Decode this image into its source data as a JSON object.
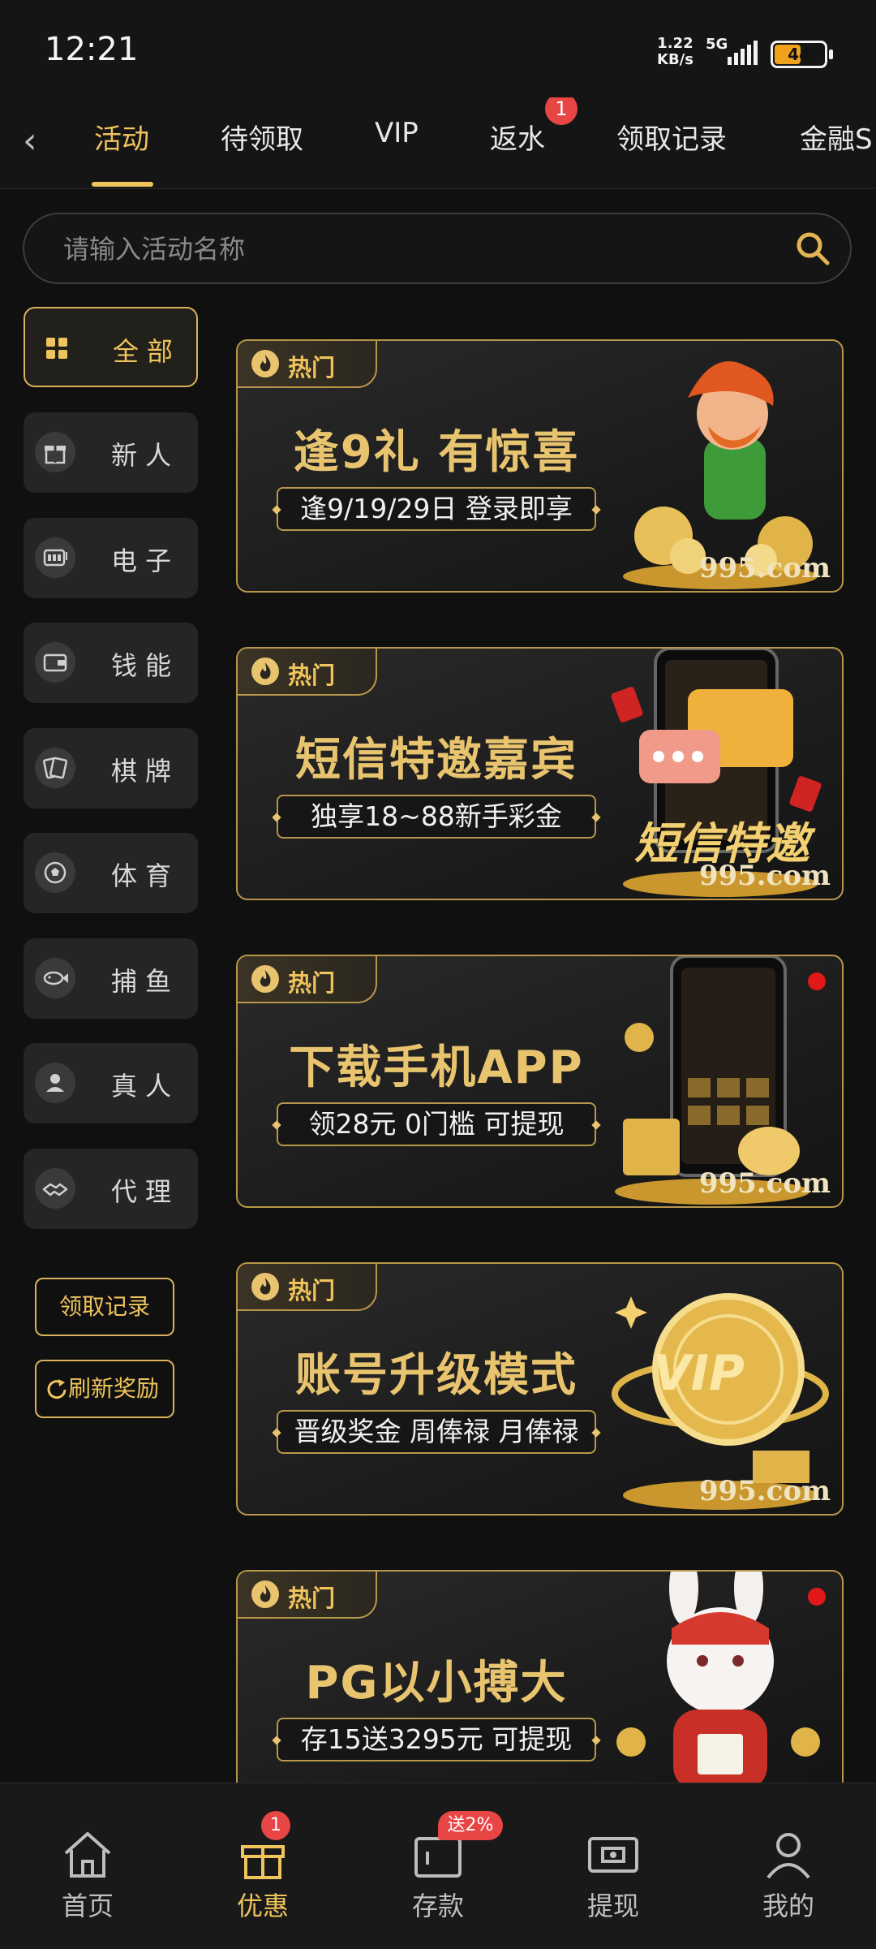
{
  "status_bar": {
    "time": "12:21",
    "net_speed": "1.22",
    "net_unit": "KB/s",
    "network": "5G",
    "battery": "44"
  },
  "tabs": {
    "items": [
      {
        "label": "活动",
        "active": true
      },
      {
        "label": "待领取"
      },
      {
        "label": "VIP"
      },
      {
        "label": "返水",
        "badge": "1"
      },
      {
        "label": "领取记录"
      },
      {
        "label": "金融S"
      }
    ]
  },
  "search": {
    "placeholder": "请输入活动名称"
  },
  "sidebar": {
    "items": [
      {
        "label": "全部",
        "icon": "grid-icon",
        "active": true
      },
      {
        "label": "新人",
        "icon": "gift-icon"
      },
      {
        "label": "电子",
        "icon": "slot-machine-icon"
      },
      {
        "label": "钱能",
        "icon": "wallet-icon"
      },
      {
        "label": "棋牌",
        "icon": "cards-icon"
      },
      {
        "label": "体育",
        "icon": "soccer-ball-icon"
      },
      {
        "label": "捕鱼",
        "icon": "fish-icon"
      },
      {
        "label": "真人",
        "icon": "person-icon"
      },
      {
        "label": "代理",
        "icon": "handshake-icon"
      }
    ],
    "record_button": "领取记录",
    "refresh_button": "刷新奖励"
  },
  "cards": [
    {
      "hot": "热门",
      "title": "逢9礼 有惊喜",
      "subtitle": "逢9/19/29日 登录即享",
      "domain": "995.com",
      "art": "leprechaun-with-gold-coins"
    },
    {
      "hot": "热门",
      "title": "短信特邀嘉宾",
      "subtitle": "独享18~88新手彩金",
      "domain": "995.com",
      "art_text": "短信特邀",
      "art": "phone-with-message-bubble"
    },
    {
      "hot": "热门",
      "title": "下载手机APP",
      "subtitle": "领28元 0门槛 可提现",
      "domain": "995.com",
      "art": "phone-with-gift-and-piggy-bank"
    },
    {
      "hot": "热门",
      "title": "账号升级模式",
      "subtitle": "晋级奖金 周俸禄 月俸禄",
      "domain": "995.com",
      "art_text": "VIP",
      "art": "gold-vip-coin"
    },
    {
      "hot": "热门",
      "title": "PG以小搏大",
      "subtitle": "存15送3295元 可提现",
      "art": "rabbit-mascot"
    }
  ],
  "bottom_nav": {
    "items": [
      {
        "label": "首页",
        "icon": "home-icon"
      },
      {
        "label": "优惠",
        "icon": "gift-box-icon",
        "active": true,
        "badge": "1"
      },
      {
        "label": "存款",
        "icon": "deposit-icon",
        "badge": "送2%"
      },
      {
        "label": "提现",
        "icon": "withdraw-icon"
      },
      {
        "label": "我的",
        "icon": "profile-icon"
      }
    ]
  },
  "colors": {
    "accent": "#f0c45c",
    "border_gold": "#b8974a",
    "badge_red": "#e84545",
    "background": "#101010"
  }
}
